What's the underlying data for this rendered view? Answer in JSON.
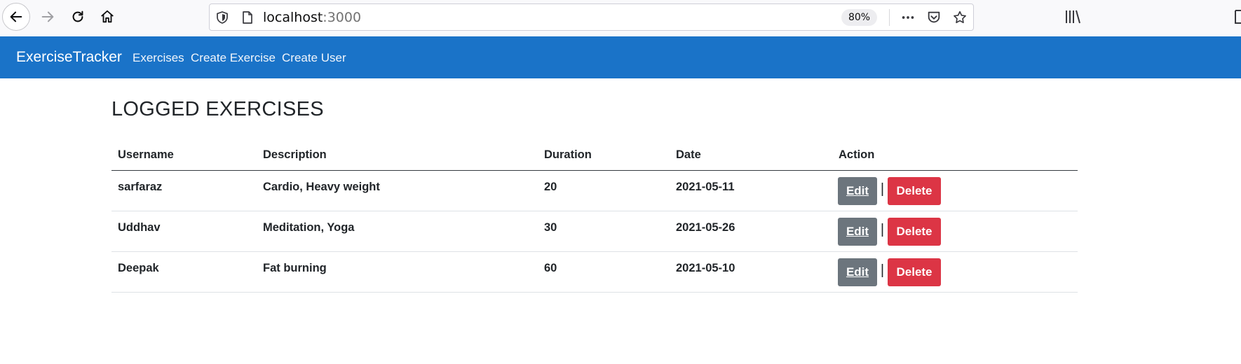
{
  "browser": {
    "url_host": "localhost",
    "url_port": ":3000",
    "zoom": "80%"
  },
  "navbar": {
    "brand": "ExerciseTracker",
    "links": [
      "Exercises",
      "Create Exercise",
      "Create User"
    ]
  },
  "page": {
    "title": "LOGGED EXERCISES"
  },
  "table": {
    "headers": [
      "Username",
      "Description",
      "Duration",
      "Date",
      "Action"
    ],
    "rows": [
      {
        "username": "sarfaraz",
        "description": "Cardio, Heavy weight",
        "duration": "20",
        "date": "2021-05-11"
      },
      {
        "username": "Uddhav",
        "description": "Meditation, Yoga",
        "duration": "30",
        "date": "2021-05-26"
      },
      {
        "username": "Deepak",
        "description": "Fat burning",
        "duration": "60",
        "date": "2021-05-10"
      }
    ],
    "edit_label": "Edit",
    "separator": "|",
    "delete_label": "Delete"
  },
  "colors": {
    "navbar": "#1a73c8",
    "edit_button": "#6c757d",
    "delete_button": "#dc3545"
  }
}
